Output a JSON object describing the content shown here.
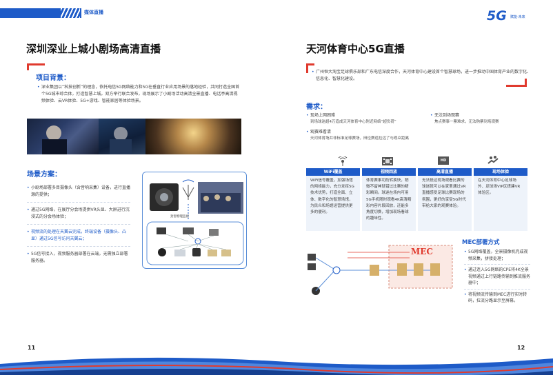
{
  "header": {
    "section_label": "媒体直播",
    "logo_mark": "5G",
    "logo_text": "赋能·未来"
  },
  "left": {
    "title": "深圳深业上城小剧场高清直播",
    "background_heading": "项目背景：",
    "background_text": "深业集团以“科技创新”的理念，依托电信5G网络能力和5G在垂直行业应用场景的落地经验，共同打造全国首个5G城市综合体，打造智慧上城。双方举行联合发布，现场展示了小剧场活动高清全景直播、电话亭高清视频体验、云VR体验、5G+游戏、智能家居等体验场景。",
    "scenario_heading": "场景方案：",
    "scenario_bullets": [
      "小剧场部署多目摄像头（含音响采集）设备，进行直播源的提供；",
      "通过5G网络，在展厅分会场提供VR头显、大屏进行沉浸式的分会场体验；",
      "视频流的处理在天翼云完成，终端设备（摄像头、凸显）通过5G信号访问天翼云；",
      "5G信号接入，视频服务器部署在云端，无需独立部署服务器。"
    ],
    "diagram_caption": "封窗物理监视",
    "page_number": "11"
  },
  "right": {
    "title": "天河体育中心5G直播",
    "intro_text": "广州恒大淘宝足球俱乐部和广东电信深度合作，天河体育中心建设首个智慧球场，进一步推动中国体育产业的数字化、信息化、智慧化建设。",
    "needs_heading": "需求：",
    "needs": [
      {
        "title": "现场上网困难",
        "detail": "到场球迷超4万造成天河体育中心附近网络“超负荷”"
      },
      {
        "title": "无法到场观赛",
        "detail": "焦点赛事一票难求，无法购票到场观赛"
      },
      {
        "title": "观赛难看清",
        "detail": "天河体育场并非标准足球赛场，田径赛道拉远了与观众距离"
      }
    ],
    "features": [
      {
        "icon": "wifi-icon",
        "title": "WiFi覆盖",
        "text": "WiFi信号覆盖，加强场馆的网络能力，充分发挥5G技术优势，打造全面、立体、数字化的智慧场馆，为民众和场馆运营提供更多的便利。"
      },
      {
        "icon": "film-icon",
        "title": "视频回放",
        "text": "体育赛事功防转换快，稍微不留神就错过比赛的精彩瞬间。球迷在场内可用5G手机随时观看4K高清精彩内容片段回放，还能多角度切换，增加现场看球的趣味性。"
      },
      {
        "icon": "hd-icon",
        "title": "高清直播",
        "text": "无法抵达现场观看比赛的球迷就可以在家里通过VR直播感受足球比赛现场的氛围，更好的享受5G时代带给大家的观赛体验。"
      },
      {
        "icon": "hands-icon",
        "title": "现场体验",
        "text": "在天河体育中心足球场外、足球场VIP区搭建VR体验区。"
      }
    ],
    "mec_heading": "MEC部署方式",
    "mec_label": "MEC",
    "mec_bullets": [
      "5G网络覆盖，全景摄像机完成视频采集，拼接处理；",
      "通过连入5G网络的CPE将4K全景视频通过上行链路传输到推流服务器中；",
      "将视频流传输到MEC进行实时转码，拉流分路显示至屏幕。"
    ],
    "page_number": "12"
  },
  "colors": {
    "brand_blue": "#1e5bc8",
    "accent_red": "#e03a2e",
    "card_bg": "#eef3fa"
  }
}
